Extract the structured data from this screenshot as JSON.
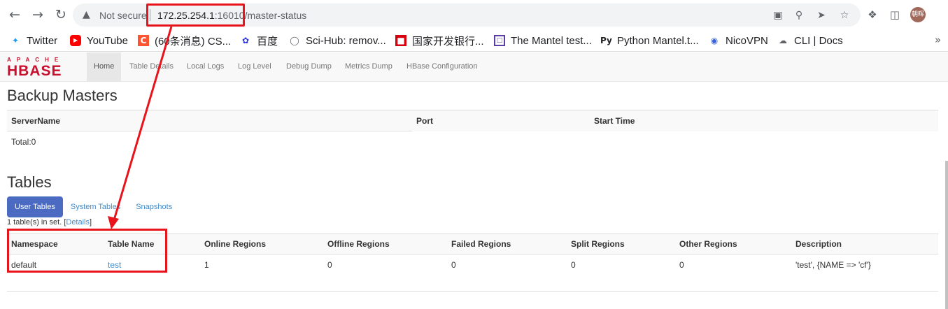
{
  "browser": {
    "security_label": "Not secure",
    "url_host": "172.25.254.1",
    "url_rest": ":16010/master-status",
    "avatar_text": "朝晖",
    "icons": [
      "back-arrow-icon",
      "forward-arrow-icon",
      "reload-icon",
      "warning-icon",
      "translate-icon",
      "zoom-icon",
      "send-icon",
      "star-icon",
      "extensions-icon",
      "sidepanel-icon"
    ]
  },
  "bookmarks": [
    {
      "label": "Twitter",
      "icon": "twitter-icon"
    },
    {
      "label": "YouTube",
      "icon": "youtube-icon"
    },
    {
      "label": "(60条消息) CS...",
      "icon": "csdn-icon"
    },
    {
      "label": "百度",
      "icon": "baidu-icon"
    },
    {
      "label": "Sci-Hub: remov...",
      "icon": "globe-icon"
    },
    {
      "label": "国家开发银行...",
      "icon": "bank-icon"
    },
    {
      "label": "The Mantel test...",
      "icon": "page-icon"
    },
    {
      "label": "Python Mantel.t...",
      "icon": "python-icon"
    },
    {
      "label": "NicoVPN",
      "icon": "vpn-icon"
    },
    {
      "label": "CLI | Docs",
      "icon": "cloud-icon"
    }
  ],
  "hbase": {
    "logo_top": "APACHE",
    "logo_main": "HBASE",
    "nav": [
      "Home",
      "Table Details",
      "Local Logs",
      "Log Level",
      "Debug Dump",
      "Metrics Dump",
      "HBase Configuration"
    ]
  },
  "backup_masters": {
    "title": "Backup Masters",
    "columns": [
      "ServerName",
      "Port",
      "Start Time"
    ],
    "total": "Total:0"
  },
  "tables": {
    "title": "Tables",
    "tabs": [
      "User Tables",
      "System Tables",
      "Snapshots"
    ],
    "count_prefix": "1 table(s) in set. [",
    "count_link": "Details",
    "count_suffix": "]",
    "columns": [
      "Namespace",
      "Table Name",
      "Online Regions",
      "Offline Regions",
      "Failed Regions",
      "Split Regions",
      "Other Regions",
      "Description"
    ],
    "rows": [
      [
        "default",
        "test",
        "1",
        "0",
        "0",
        "0",
        "0",
        "'test', {NAME => 'cf'}"
      ]
    ]
  },
  "colors": {
    "annotation": "#e8141c",
    "accent": "#4b6bc3",
    "link": "#428bca",
    "logo": "#c8102e"
  }
}
